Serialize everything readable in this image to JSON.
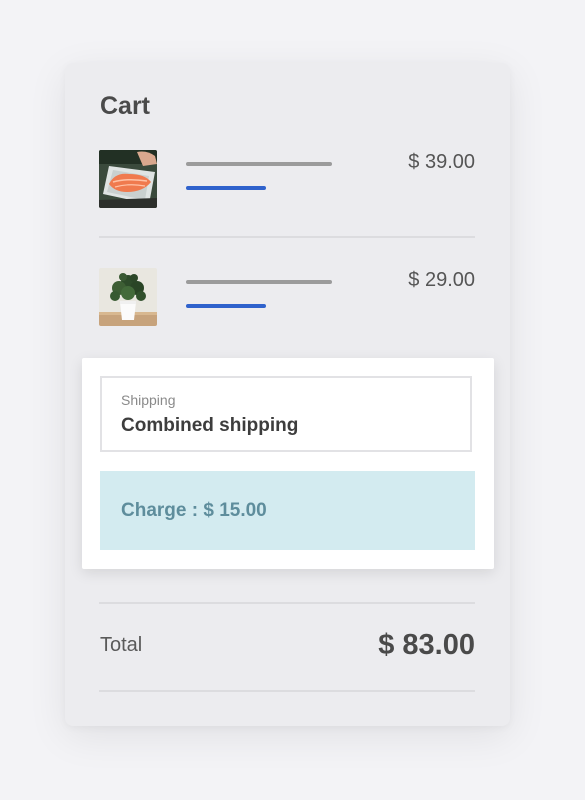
{
  "cart": {
    "title": "Cart",
    "items": [
      {
        "image": "salmon-fillet-image",
        "price": "$ 39.00"
      },
      {
        "image": "potted-plant-image",
        "price": "$ 29.00"
      }
    ]
  },
  "shipping": {
    "label": "Shipping",
    "value": "Combined shipping",
    "charge": "Charge : $ 15.00"
  },
  "total": {
    "label": "Total",
    "value": "$ 83.00"
  },
  "colors": {
    "background": "#f3f3f6",
    "card": "#ececef",
    "accent_blue": "#2f62cc",
    "charge_bg": "#d3ebf0",
    "charge_text": "#5e8d9c"
  }
}
